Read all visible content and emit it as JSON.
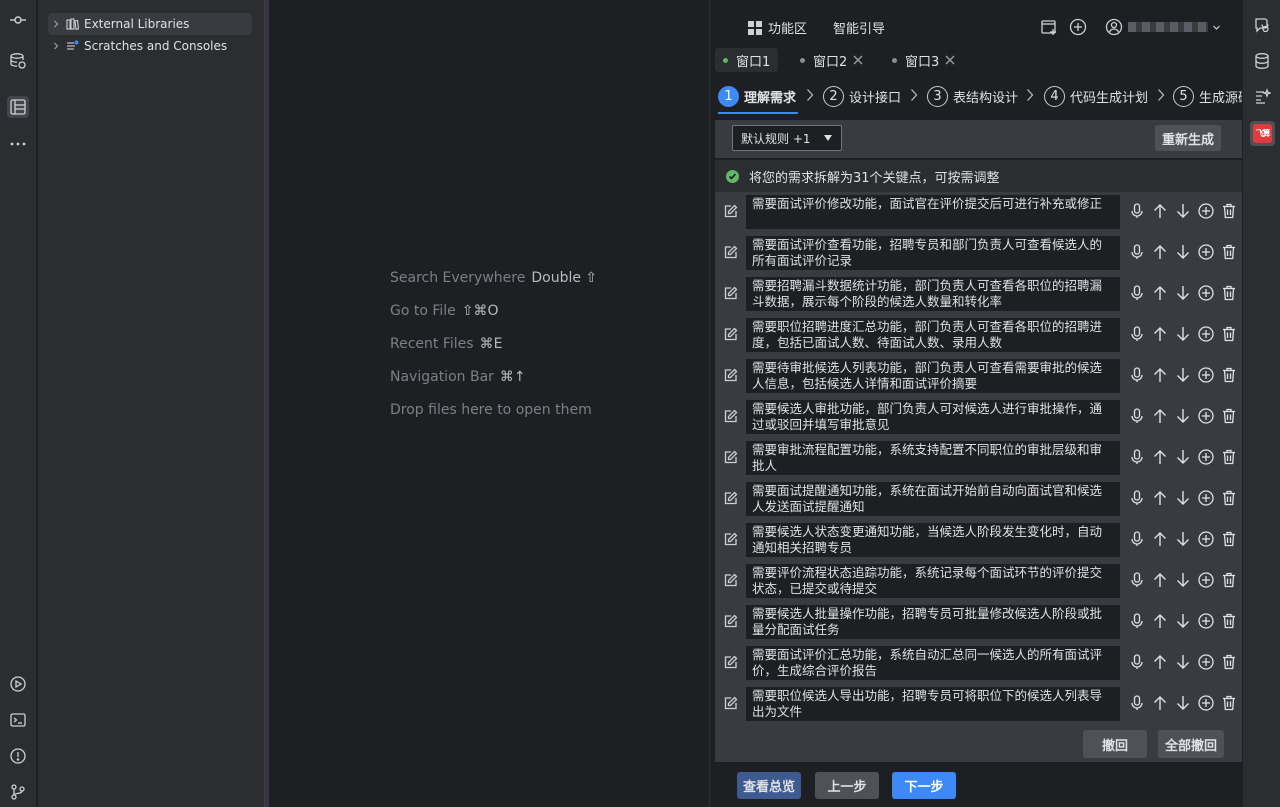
{
  "project": {
    "items": [
      {
        "label": "External Libraries"
      },
      {
        "label": "Scratches and Consoles"
      }
    ]
  },
  "editor": {
    "hints": [
      {
        "label": "Search Everywhere",
        "shortcut": "Double ⇧"
      },
      {
        "label": "Go to File",
        "shortcut": "⇧⌘O"
      },
      {
        "label": "Recent Files",
        "shortcut": "⌘E"
      },
      {
        "label": "Navigation Bar",
        "shortcut": "⌘↑"
      },
      {
        "label": "Drop files here to open them",
        "shortcut": ""
      }
    ]
  },
  "plugin": {
    "nav": {
      "features": "功能区",
      "guide": "智能引导"
    },
    "window_tabs": [
      {
        "label": "窗口1",
        "active": true
      },
      {
        "label": "窗口2",
        "active": false
      },
      {
        "label": "窗口3",
        "active": false
      }
    ],
    "steps": [
      {
        "num": "1",
        "label": "理解需求"
      },
      {
        "num": "2",
        "label": "设计接口"
      },
      {
        "num": "3",
        "label": "表结构设计"
      },
      {
        "num": "4",
        "label": "代码生成计划"
      },
      {
        "num": "5",
        "label": "生成源码"
      }
    ],
    "rules_select": "默认规则 +1",
    "regenerate": "重新生成",
    "summary": "将您的需求拆解为31个关键点，可按需调整",
    "requirements": [
      "需要面试评价修改功能，面试官在评价提交后可进行补充或修正",
      "需要面试评价查看功能，招聘专员和部门负责人可查看候选人的所有面试评价记录",
      "需要招聘漏斗数据统计功能，部门负责人可查看各职位的招聘漏斗数据，展示每个阶段的候选人数量和转化率",
      "需要职位招聘进度汇总功能，部门负责人可查看各职位的招聘进度，包括已面试人数、待面试人数、录用人数",
      "需要待审批候选人列表功能，部门负责人可查看需要审批的候选人信息，包括候选人详情和面试评价摘要",
      "需要候选人审批功能，部门负责人可对候选人进行审批操作，通过或驳回并填写审批意见",
      "需要审批流程配置功能，系统支持配置不同职位的审批层级和审批人",
      "需要面试提醒通知功能，系统在面试开始前自动向面试官和候选人发送面试提醒通知",
      "需要候选人状态变更通知功能，当候选人阶段发生变化时，自动通知相关招聘专员",
      "需要评价流程状态追踪功能，系统记录每个面试环节的评价提交状态，已提交或待提交",
      "需要候选人批量操作功能，招聘专员可批量修改候选人阶段或批量分配面试任务",
      "需要面试评价汇总功能，系统自动汇总同一候选人的所有面试评价，生成综合评价报告",
      "需要职位候选人导出功能，招聘专员可将职位下的候选人列表导出为文件"
    ],
    "undo": "撤回",
    "undo_all": "全部撤回",
    "overview": "查看总览",
    "prev": "上一步",
    "next": "下一步"
  },
  "right_strip": {
    "badge": "飞算"
  },
  "colors": {
    "accent": "#3d8af7",
    "success": "#5fb865",
    "badge": "#e03c3c"
  }
}
